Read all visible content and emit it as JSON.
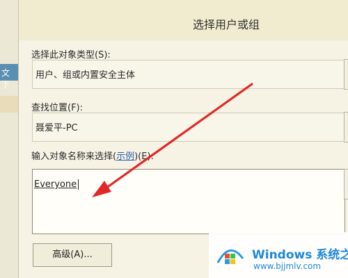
{
  "background": {
    "fragment_text": "文 下"
  },
  "dialog": {
    "title": "选择用户或组",
    "object_type_label": "选择此对象类型(S):",
    "object_type_value": "用户、组或内置安全主体",
    "location_label": "查找位置(F):",
    "location_value": "聂爱平-PC",
    "enter_names_label_prefix": "输入对象名称来选择(",
    "enter_names_link": "示例",
    "enter_names_label_suffix": ")(E):",
    "names_value": "Everyone",
    "advanced_button": "高级(A)..."
  },
  "annotation": {
    "arrow_color": "#e0282a"
  },
  "watermark": {
    "brand": "Windows",
    "brand_cn": "系统之家",
    "url": "www.bjjmlv.com"
  }
}
